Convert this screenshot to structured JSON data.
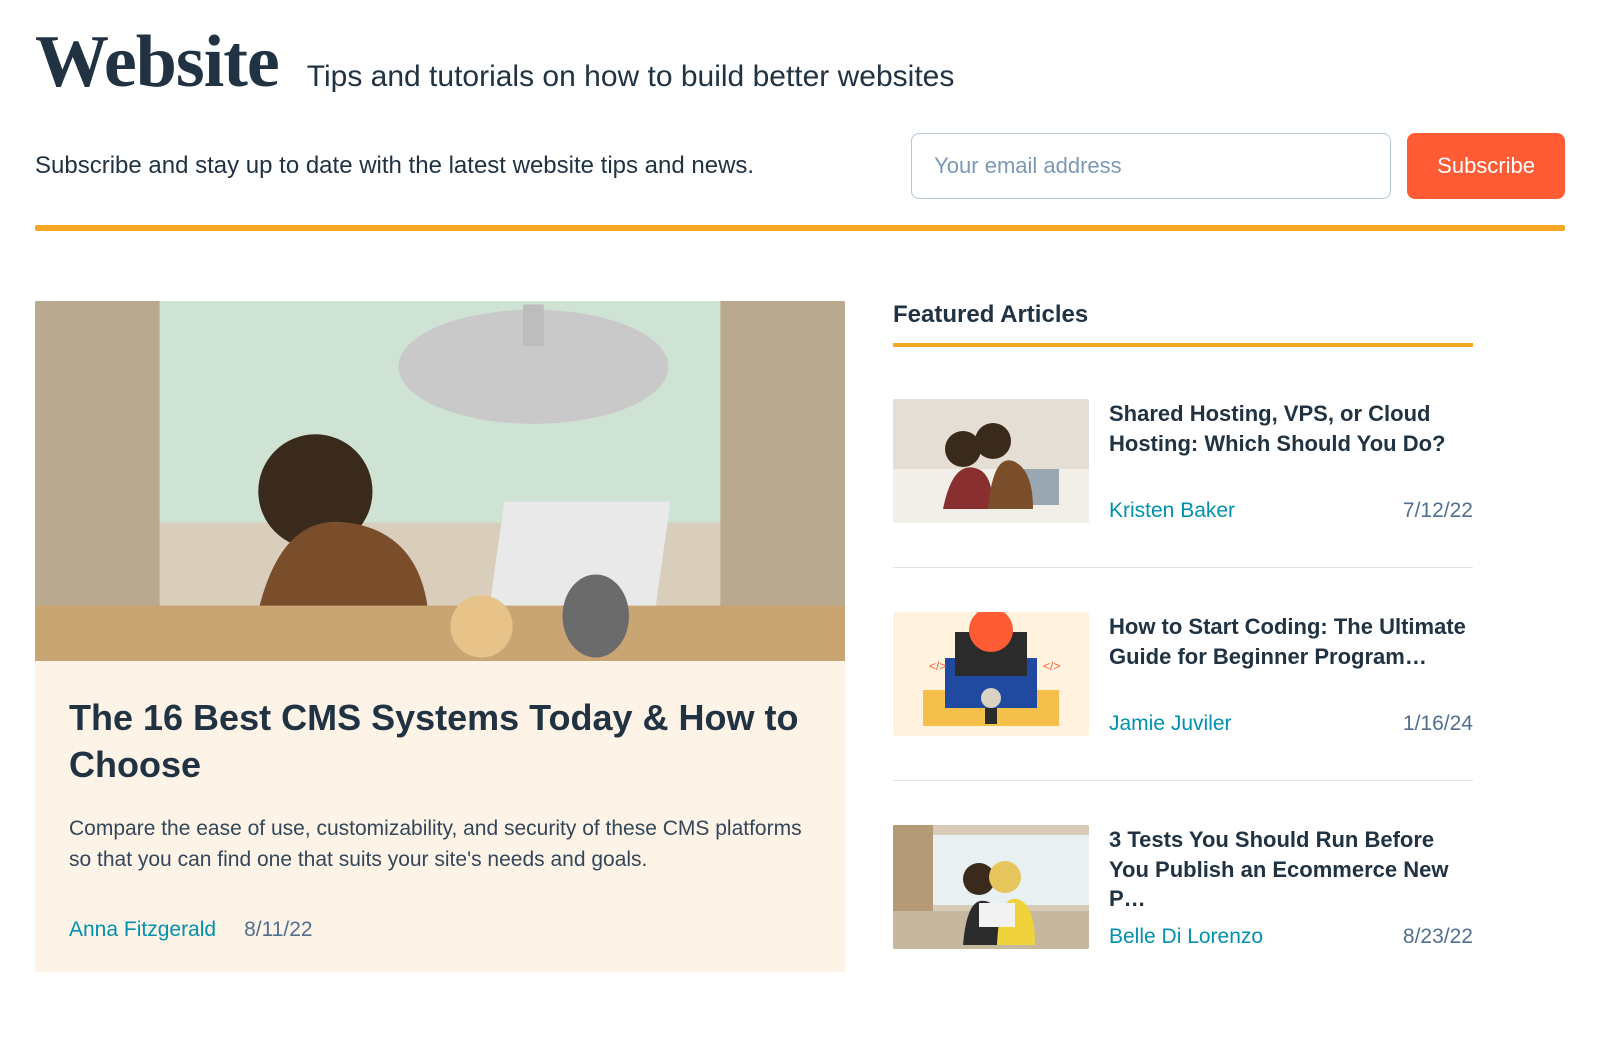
{
  "header": {
    "wordmark": "Website",
    "tagline": "Tips and tutorials on how to build better websites"
  },
  "subscribe": {
    "prompt": "Subscribe and stay up to date with the latest website tips and news.",
    "placeholder": "Your email address",
    "button": "Subscribe"
  },
  "hero": {
    "title": "The 16 Best CMS Systems Today & How to Choose",
    "description": "Compare the ease of use, customizability, and security of these CMS platforms so that you can find one that suits your site's needs and goals.",
    "author": "Anna Fitzgerald",
    "date": "8/11/22"
  },
  "featured": {
    "heading": "Featured Articles",
    "items": [
      {
        "title": "Shared Hosting, VPS, or Cloud Hosting: Which Should You Do?",
        "author": "Kristen Baker",
        "date": "7/12/22"
      },
      {
        "title": "How to Start Coding: The Ultimate Guide for Beginner Program…",
        "author": "Jamie Juviler",
        "date": "1/16/24"
      },
      {
        "title": "3 Tests You Should Run Before You Publish an Ecommerce New P…",
        "author": "Belle Di Lorenzo",
        "date": "8/23/22"
      }
    ]
  }
}
